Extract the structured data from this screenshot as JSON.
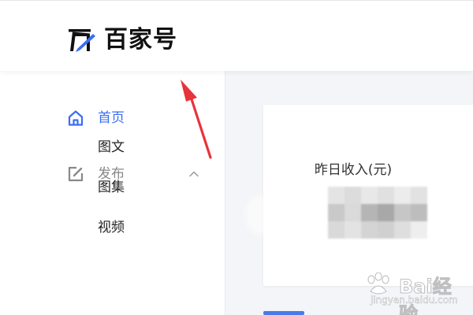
{
  "header": {
    "logo_text": "百家号",
    "logo_icon": "baijiahao-logo-icon"
  },
  "sidebar": {
    "items": [
      {
        "label": "首页",
        "icon": "home-icon",
        "active": true
      },
      {
        "label": "发布",
        "icon": "edit-icon",
        "expanded": true,
        "chevron": "chevron-up-icon"
      }
    ],
    "sub_items": [
      "图文",
      "图集",
      "视频"
    ]
  },
  "card": {
    "title": "昨日收入(元)"
  },
  "watermark": {
    "brand": "Bai经验",
    "url": "jingyan.baidu.com"
  },
  "colors": {
    "accent": "#3b6df5",
    "arrow": "#e8333a",
    "background": "#f4f5f9"
  }
}
